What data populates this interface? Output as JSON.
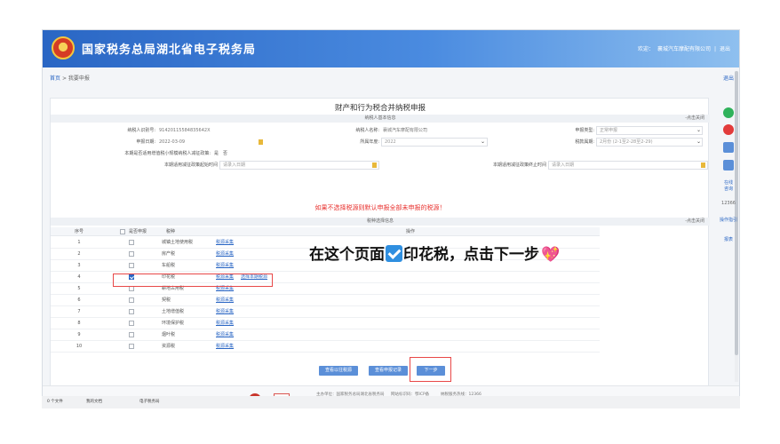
{
  "header": {
    "title": "国家税务总局湖北省电子税务局",
    "user_prefix": "欢迎：",
    "user_company": "襄城汽车摩配有限公司",
    "logout": "退出"
  },
  "breadcrumb": {
    "home": "首页",
    "sep": ">",
    "current": "我要申报",
    "exit": "退出"
  },
  "form": {
    "title": "财产和行为税合并纳税申报",
    "basic_section": "纳税人基本信息",
    "basic_toggle": "-点击关闭",
    "taxpayer_id_label": "纳税人识别号:",
    "taxpayer_id": "91420115584835642X",
    "taxpayer_name_label": "纳税人名称:",
    "taxpayer_name": "襄城汽车摩配有限公司",
    "declare_type_label": "申报类型:",
    "declare_type": "正常申报",
    "declare_date_label": "申报日期:",
    "declare_date": "2022-03-09",
    "year_label": "所属年度:",
    "year": "2022",
    "period_label": "税款属期:",
    "period": "2月份 (2-1至2-28至2-29)",
    "small_taxpayer_label": "本期是否适用增值税小规模纳税人减征政策:",
    "small_yes": "是",
    "small_no": "否",
    "policy_start_label": "本期适用减征政策起始时间",
    "policy_end_label": "本期适用减征政策终止时间",
    "date_placeholder": "请录入日期",
    "warning": "如果不选择税源则默认申报全部未申报的税源！",
    "tax_section": "税种选择信息",
    "tax_toggle": "-点击关闭"
  },
  "table": {
    "headers": [
      "序号",
      "是否申报",
      "税种",
      "操作"
    ],
    "rows": [
      {
        "seq": "1",
        "name": "城镇土地使用税",
        "op": "税源采集",
        "checked": false
      },
      {
        "seq": "2",
        "name": "房产税",
        "op": "税源采集",
        "checked": false
      },
      {
        "seq": "3",
        "name": "车船税",
        "op": "税源采集",
        "checked": false
      },
      {
        "seq": "4",
        "name": "印花税",
        "op": "税源采集",
        "op2": "选择本期税源",
        "checked": true
      },
      {
        "seq": "5",
        "name": "耕地占用税",
        "op": "税源采集",
        "checked": false
      },
      {
        "seq": "6",
        "name": "契税",
        "op": "税源采集",
        "checked": false
      },
      {
        "seq": "7",
        "name": "土地增值税",
        "op": "税源采集",
        "checked": false
      },
      {
        "seq": "8",
        "name": "环境保护税",
        "op": "税源采集",
        "checked": false
      },
      {
        "seq": "9",
        "name": "烟叶税",
        "op": "税源采集",
        "checked": false
      },
      {
        "seq": "10",
        "name": "资源税",
        "op": "税源采集",
        "checked": false
      }
    ]
  },
  "buttons": {
    "query_btn": "查看以往税源",
    "record_btn": "查看申报记录",
    "next": "下一步"
  },
  "right_tools": {
    "online": "在线",
    "consult": "咨询",
    "exit": "退出",
    "hotline": "12366",
    "guide": "操作指引",
    "report": "报表"
  },
  "footer": {
    "line1": "主办单位：国家税务总局湖北省税务局",
    "line2": "网站标识码：鄂ICP备",
    "line3": "纳税服务热线：12366"
  },
  "taskbar": {
    "item1": "0 个文件",
    "item2": "我的文档",
    "item3": "电子税务局"
  },
  "annotation": {
    "prefix": "在这个页面",
    "suffix": "印花税，点击下一步",
    "heart": "💖"
  },
  "colors": {
    "brand": "#2a66c4",
    "warning": "#e8322f",
    "highlight": "#e84848"
  }
}
